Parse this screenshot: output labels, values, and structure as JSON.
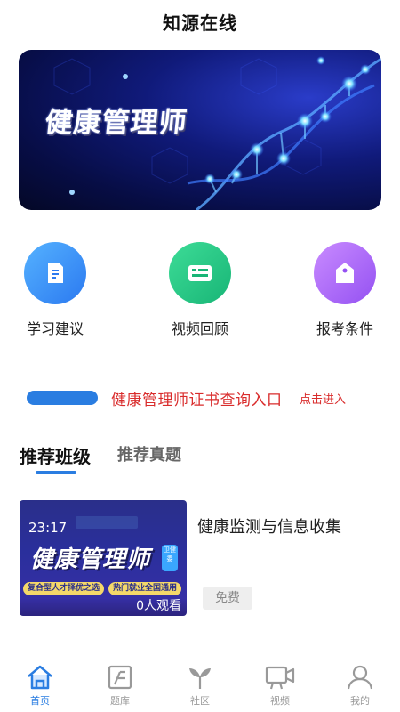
{
  "header": {
    "title": "知源在线"
  },
  "banner": {
    "text": "健康管理师"
  },
  "shortcuts": [
    {
      "label": "学习建议",
      "icon": "document-icon",
      "color": "#2b79f0"
    },
    {
      "label": "视频回顾",
      "icon": "video-card-icon",
      "color": "#18b576"
    },
    {
      "label": "报考条件",
      "icon": "tag-icon",
      "color": "#9451f2"
    }
  ],
  "certificate": {
    "text": "健康管理师证书查询入口",
    "link": "点击进入",
    "color": "#d92c2c"
  },
  "tabs": [
    {
      "label": "推荐班级",
      "active": true
    },
    {
      "label": "推荐真题",
      "active": false
    }
  ],
  "course": {
    "thumb_time": "23:17",
    "thumb_title": "健康管理师",
    "thumb_tag": "卫健委",
    "thumb_chip1": "复合型人才择优之选",
    "thumb_chip2": "热门就业全国通用",
    "views": "0人观看",
    "title": "健康监测与信息收集",
    "price_badge": "免费"
  },
  "tabbar": [
    {
      "label": "首页",
      "icon": "home-icon",
      "active": true
    },
    {
      "label": "题库",
      "icon": "question-bank-icon",
      "active": false
    },
    {
      "label": "社区",
      "icon": "sprout-icon",
      "active": false
    },
    {
      "label": "视频",
      "icon": "video-camera-icon",
      "active": false
    },
    {
      "label": "我的",
      "icon": "user-icon",
      "active": false
    }
  ],
  "colors": {
    "accent": "#2a7de1",
    "inactive": "#999999"
  }
}
